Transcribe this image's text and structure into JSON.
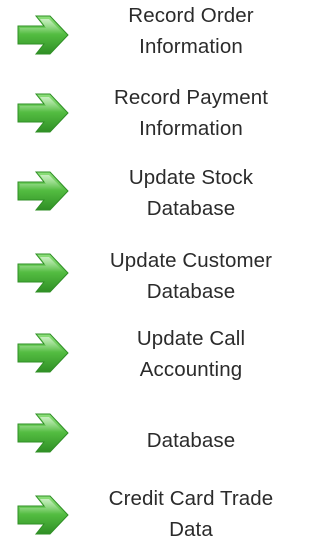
{
  "colors": {
    "arrow_light": "#7ed56b",
    "arrow_mid": "#4cb43a",
    "arrow_dark": "#2f8f25",
    "text": "#2b2b2b"
  },
  "items": [
    {
      "label": "Record  Order\nInformation",
      "icon": "right-arrow-icon"
    },
    {
      "label": "Record Payment\nInformation",
      "icon": "right-arrow-icon"
    },
    {
      "label": "Update Stock\nDatabase",
      "icon": "right-arrow-icon"
    },
    {
      "label": "Update Customer\nDatabase",
      "icon": "right-arrow-icon"
    },
    {
      "label": "Update Call\nAccounting",
      "icon": "right-arrow-icon"
    },
    {
      "label": "Database",
      "icon": "right-arrow-icon"
    },
    {
      "label": "Credit Card Trade\nData",
      "icon": "right-arrow-icon"
    }
  ]
}
